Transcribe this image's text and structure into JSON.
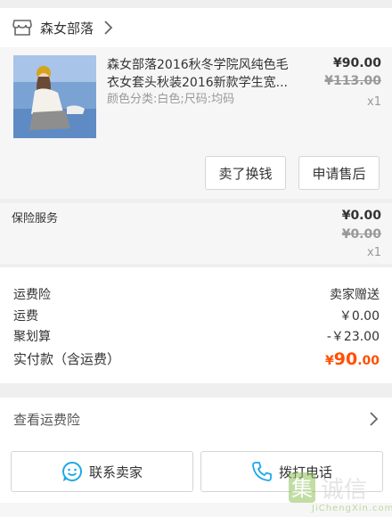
{
  "shop": {
    "name": "森女部落",
    "icon": "shop-icon"
  },
  "item": {
    "title_line1": "森女部落2016秋冬学院风纯色毛",
    "title_line2": "衣女套头秋装2016新款学生宽...",
    "sku": "颜色分类:白色;尺码:均码",
    "price": "¥90.00",
    "original_price": "¥113.00",
    "quantity": "x1",
    "thumbnail": "product-photo"
  },
  "actions": {
    "sell_label": "卖了换钱",
    "after_sale_label": "申请售后"
  },
  "insurance_item": {
    "label": "保险服务",
    "price": "¥0.00",
    "original_price": "¥0.00",
    "quantity": "x1"
  },
  "costs": {
    "shipping_insurance_label": "运费险",
    "shipping_insurance_value": "卖家赠送",
    "shipping_label": "运费",
    "shipping_value": "￥0.00",
    "discount_label": "聚划算",
    "discount_value": "-￥23.00",
    "total_label": "实付款（含运费）",
    "total_currency": "¥",
    "total_main": "90",
    "total_decimal": ".00"
  },
  "insurance_link": {
    "label": "查看运费险"
  },
  "bottom": {
    "contact_label": "联系卖家",
    "call_label": "拨打电话"
  },
  "watermark": {
    "text": "JiChengXin.com",
    "glyph1": "集",
    "glyph2": "诚信"
  },
  "colors": {
    "accent": "#ff5000",
    "icon_blue": "#1ea8e7",
    "watermark_green": "#8fc25a"
  }
}
